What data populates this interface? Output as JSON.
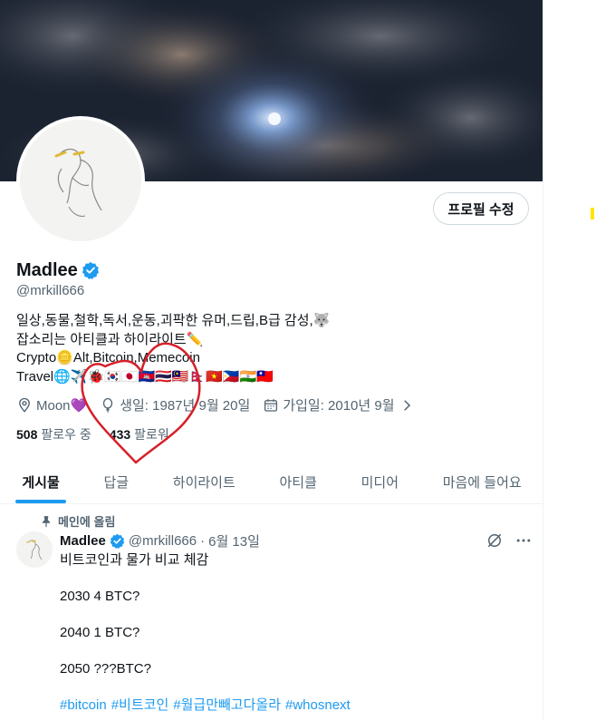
{
  "profile": {
    "display_name": "Madlee",
    "handle": "@mrkill666",
    "edit_button": "프로필 수정",
    "bio": [
      "일상,동물,철학,독서,운동,괴팍한 유머,드립,B급 감성,🐺",
      "잡소리는 아티클과 하이라이트✏️",
      "Crypto🪙Alt,Bitcoin,Memecoin",
      "Travel🌐✈️🐞🇰🇷🇯🇵🇰🇭🇹🇭🇲🇾🇳🇵🇻🇳🇵🇭🇮🇳🇹🇼"
    ],
    "location": "Moon💜",
    "birthday": "생일: 1987년 9월 20일",
    "joined": "가입일: 2010년 9월",
    "following_count": "508",
    "following_label": "팔로우 중",
    "followers_count": "433",
    "followers_label": "팔로워"
  },
  "tabs": [
    {
      "label": "게시물",
      "active": true
    },
    {
      "label": "답글",
      "active": false
    },
    {
      "label": "하이라이트",
      "active": false
    },
    {
      "label": "아티클",
      "active": false
    },
    {
      "label": "미디어",
      "active": false
    },
    {
      "label": "마음에 들어요",
      "active": false
    }
  ],
  "pinned_tweet": {
    "pinned_label": "메인에 올림",
    "author_name": "Madlee",
    "author_handle": "@mrkill666",
    "separator": "·",
    "date": "6월 13일",
    "paragraphs": [
      "비트코인과 물가 비교 체감",
      "2030 4 BTC?",
      "2040 1 BTC?",
      "2050 ???BTC?"
    ],
    "hashtags": [
      "#bitcoin",
      "#비트코인",
      "#월급만빼고다올라",
      "#whosnext"
    ]
  },
  "colors": {
    "accent": "#1d9bf0",
    "text_primary": "#0f1419",
    "text_secondary": "#536471",
    "annotation": "#d6202a",
    "highlight": "#ffe500"
  },
  "icons": [
    "verified-badge-icon",
    "location-pin-icon",
    "balloon-icon",
    "calendar-icon",
    "chevron-right-icon",
    "pin-icon",
    "grok-icon",
    "more-icon"
  ]
}
